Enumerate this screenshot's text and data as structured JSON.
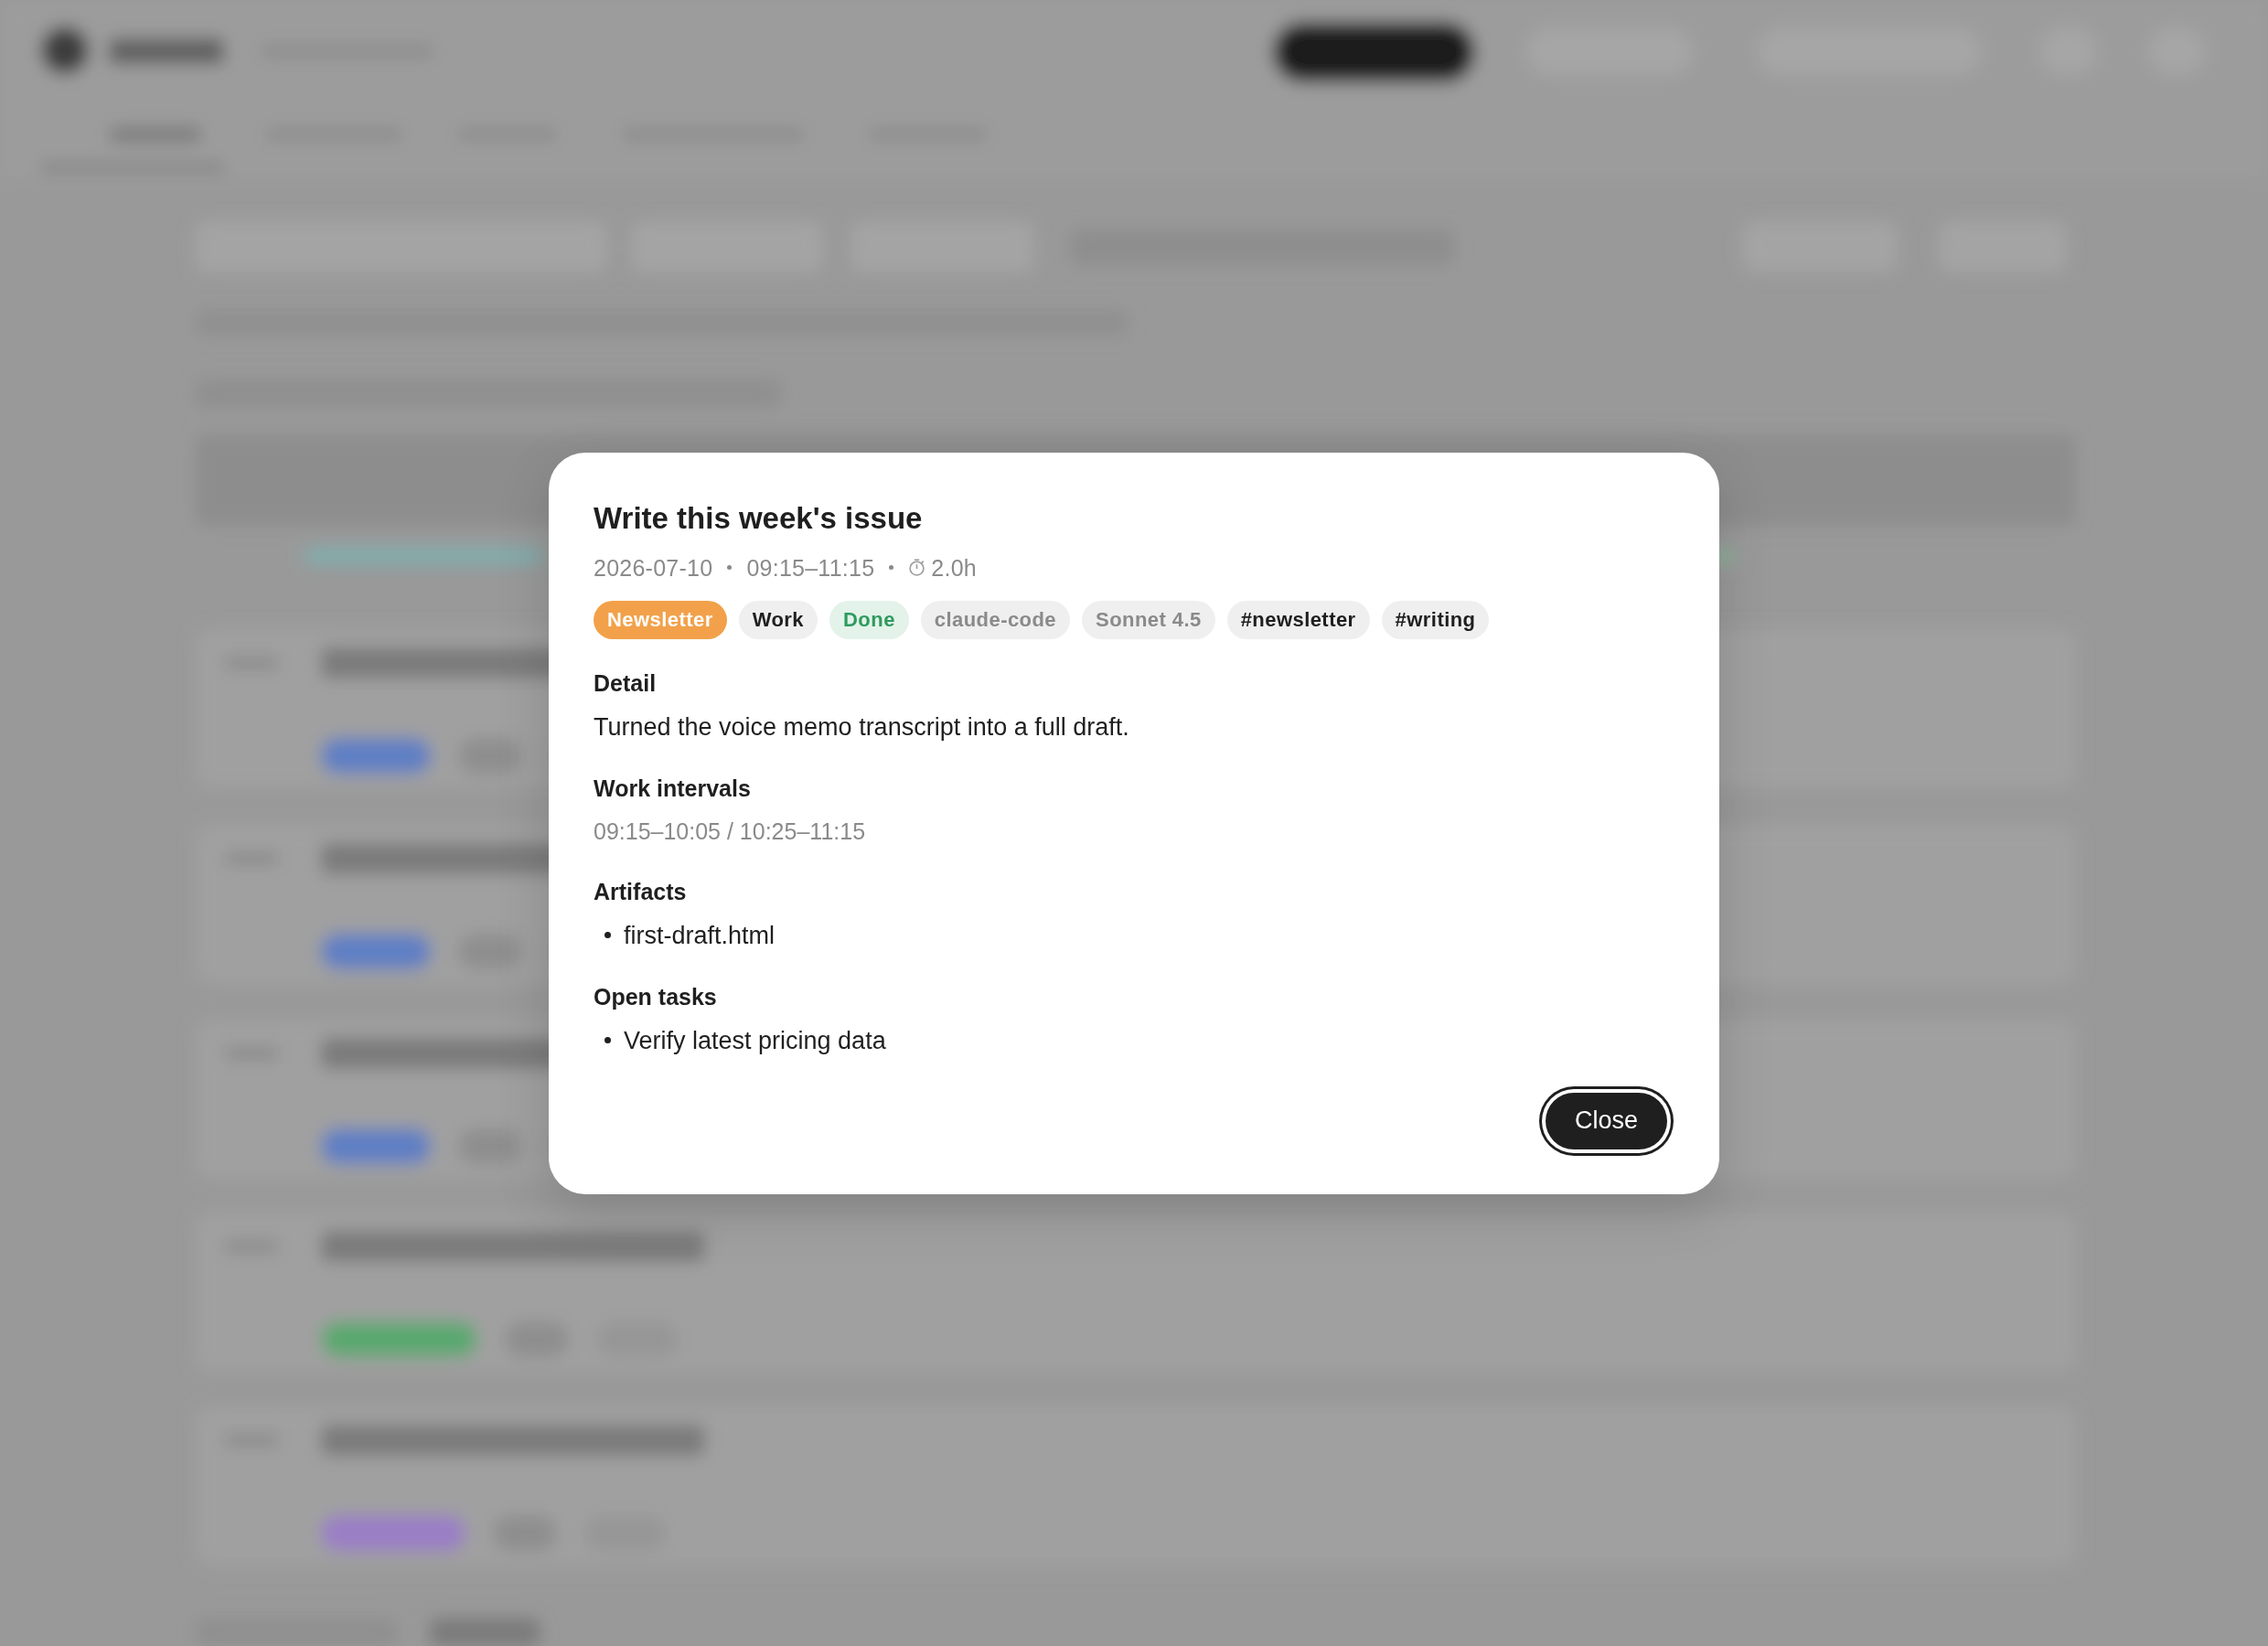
{
  "dialog": {
    "title": "Write this week's issue",
    "meta": {
      "date": "2026-07-10",
      "time_range": "09:15–11:15",
      "duration": "2.0h"
    },
    "tags": [
      {
        "label": "Newsletter",
        "kind": "category"
      },
      {
        "label": "Work",
        "kind": "project"
      },
      {
        "label": "Done",
        "kind": "status"
      },
      {
        "label": "claude-code",
        "kind": "source"
      },
      {
        "label": "Sonnet 4.5",
        "kind": "model"
      },
      {
        "label": "#newsletter",
        "kind": "hashtag"
      },
      {
        "label": "#writing",
        "kind": "hashtag"
      }
    ],
    "sections": [
      {
        "heading": "Detail",
        "kind": "text",
        "text": "Turned the voice memo transcript into a full draft."
      },
      {
        "heading": "Work intervals",
        "kind": "muted",
        "text": "09:15–10:05 / 10:25–11:15"
      },
      {
        "heading": "Artifacts",
        "kind": "list",
        "items": [
          "first-draft.html"
        ]
      },
      {
        "heading": "Open tasks",
        "kind": "list",
        "items": [
          "Verify latest pricing data"
        ]
      }
    ],
    "close_button": "Close"
  }
}
